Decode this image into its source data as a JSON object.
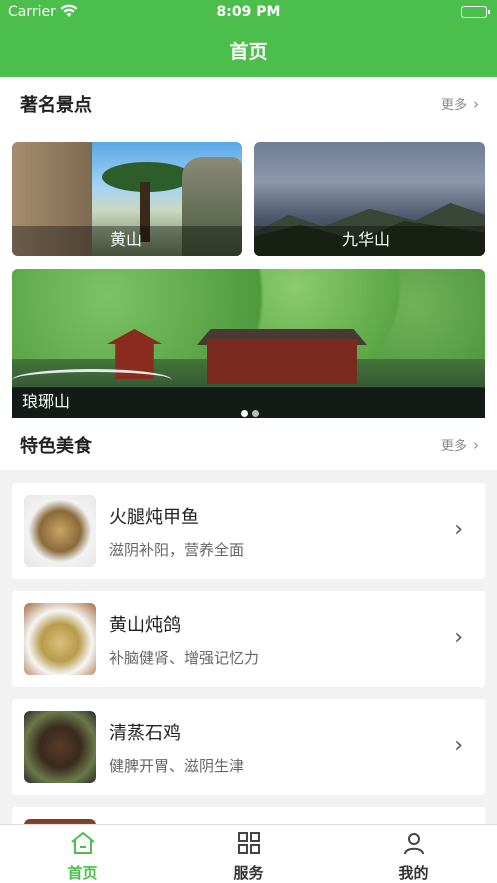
{
  "status_bar": {
    "carrier": "Carrier",
    "time": "8:09 PM"
  },
  "nav": {
    "title": "首页"
  },
  "scenic": {
    "header": "著名景点",
    "more": "更多",
    "spots": [
      {
        "name": "黄山"
      },
      {
        "name": "九华山"
      },
      {
        "name": "琅琊山"
      }
    ],
    "carousel": {
      "pages": 2,
      "active": 1
    }
  },
  "food": {
    "header": "特色美食",
    "more": "更多",
    "items": [
      {
        "name": "火腿炖甲鱼",
        "desc": "滋阴补阳，营养全面"
      },
      {
        "name": "黄山炖鸽",
        "desc": "补脑健肾、增强记忆力"
      },
      {
        "name": "清蒸石鸡",
        "desc": "健脾开胃、滋阴生津"
      }
    ]
  },
  "tabs": [
    {
      "label": "首页",
      "icon": "home-icon",
      "active": true
    },
    {
      "label": "服务",
      "icon": "grid-icon",
      "active": false
    },
    {
      "label": "我的",
      "icon": "user-icon",
      "active": false
    }
  ],
  "colors": {
    "accent": "#4cbe4c",
    "background": "#f2f2f2"
  }
}
